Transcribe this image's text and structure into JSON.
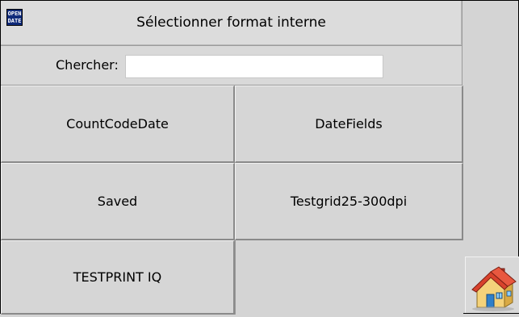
{
  "header": {
    "logo_line1": "OPEN",
    "logo_line2": "DATE",
    "title": "Sélectionner format interne"
  },
  "search": {
    "label": "Chercher:",
    "value": "",
    "placeholder": ""
  },
  "formats": [
    {
      "label": "CountCodeDate"
    },
    {
      "label": "DateFields"
    },
    {
      "label": "Saved"
    },
    {
      "label": "Testgrid25-300dpi"
    },
    {
      "label": "TESTPRINT IQ"
    }
  ],
  "icons": {
    "logo": "opendate-logo-icon",
    "home": "home-icon"
  }
}
